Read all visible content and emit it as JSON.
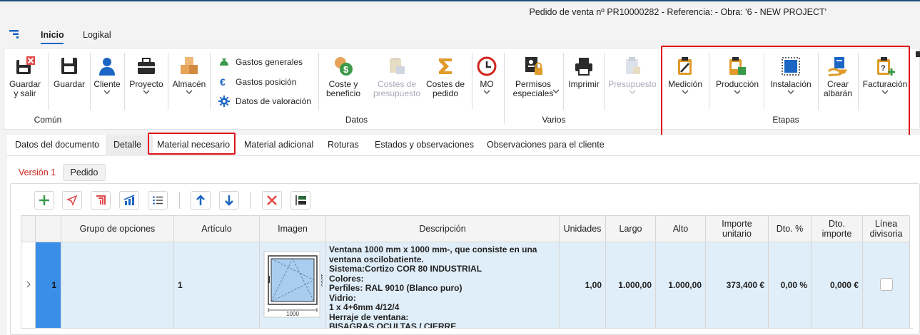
{
  "window": {
    "title": "Pedido de venta nº PR10000282 - Referencia:  - Obra: '6 - NEW PROJECT'"
  },
  "menu_tabs": [
    {
      "label": "Inicio",
      "active": true
    },
    {
      "label": "Logikal",
      "active": false
    }
  ],
  "ribbon": {
    "buttons": {
      "guardar_salir": "Guardar\ny salir",
      "guardar": "Guardar",
      "cliente": "Cliente",
      "proyecto": "Proyecto",
      "almacen": "Almacén",
      "coste_beneficio": "Coste y\nbeneficio",
      "costes_presupuesto": "Costes de\npresupuesto",
      "costes_pedido": "Costes de\npedido",
      "mo": "MO",
      "permisos": "Permisos\nespeciales",
      "imprimir": "Imprimir",
      "presupuesto": "Presupuesto",
      "medicion": "Medición",
      "produccion": "Producción",
      "instalacion": "Instalación",
      "crear_albaran": "Crear\nalbarán",
      "facturacion": "Facturación"
    },
    "datos_items": [
      "Gastos generales",
      "Gastos posición",
      "Datos de valoración"
    ],
    "groups": {
      "comun": "Común",
      "datos": "Datos",
      "varios": "Varios",
      "etapas": "Etapas"
    }
  },
  "doc_tabs": [
    "Datos del documento",
    "Detalle",
    "Material necesario",
    "Material adicional",
    "Roturas",
    "Estados y observaciones",
    "Observaciones para el cliente"
  ],
  "version": {
    "label": "Versión 1",
    "pedido_button": "Pedido"
  },
  "grid": {
    "headers": [
      "Grupo de opciones",
      "Artículo",
      "Imagen",
      "Descripción",
      "Unidades",
      "Largo",
      "Alto",
      "Importe\nunitario",
      "Dto. %",
      "Dto.\nimporte",
      "Línea\ndivisoria"
    ],
    "row": {
      "index": "1",
      "articulo": "1",
      "description": [
        "Ventana 1000 mm x 1000 mm-, que consiste en una",
        "ventana oscilobatiente.",
        "Sistema:Cortizo COR 80 INDUSTRIAL",
        "Colores:",
        "Perfiles: RAL 9010 (Blanco puro)",
        "Vidrio:",
        "1 x 4+6mm 4/12/4",
        "Herraje de ventana:",
        "BISAGRAS OCULTAS / CIERRE"
      ],
      "image_dims": {
        "width": "1000",
        "height": "1000"
      },
      "unidades": "1,00",
      "largo": "1.000,00",
      "alto": "1.000,00",
      "importe_unitario": "373,400 €",
      "dto_pct": "0,00 %",
      "dto_importe": "0,000 €",
      "linea_divisoria": false
    }
  },
  "colors": {
    "accent": "#1a66c2",
    "highlight_box": "#e0111a",
    "selected_row": "#e0eef9",
    "row_index_fill": "#3a8ee6"
  }
}
